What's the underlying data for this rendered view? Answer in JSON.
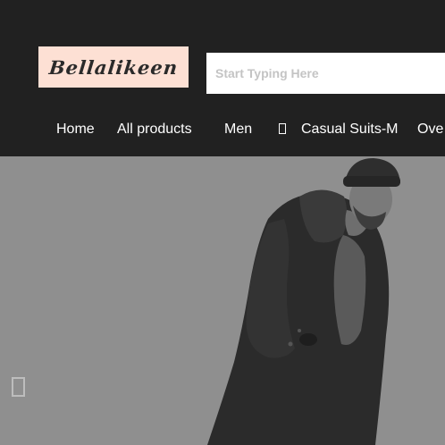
{
  "header": {
    "logo_text": "Bellalikeen",
    "search_placeholder": "Start Typing Here",
    "search_value": ""
  },
  "nav": {
    "items": [
      {
        "label": "Home"
      },
      {
        "label": "All products"
      },
      {
        "label": "Men"
      },
      {
        "label": "Casual Suits-M"
      },
      {
        "label": "Ove"
      }
    ]
  },
  "hero": {
    "image": "man-in-beanie-and-dark-coat"
  },
  "slider": {
    "prev_icon": "chevron-left-icon"
  },
  "colors": {
    "header_bg": "#212121",
    "logo_bg": "#fde0d4",
    "hero_bg": "#8f8f8f"
  }
}
